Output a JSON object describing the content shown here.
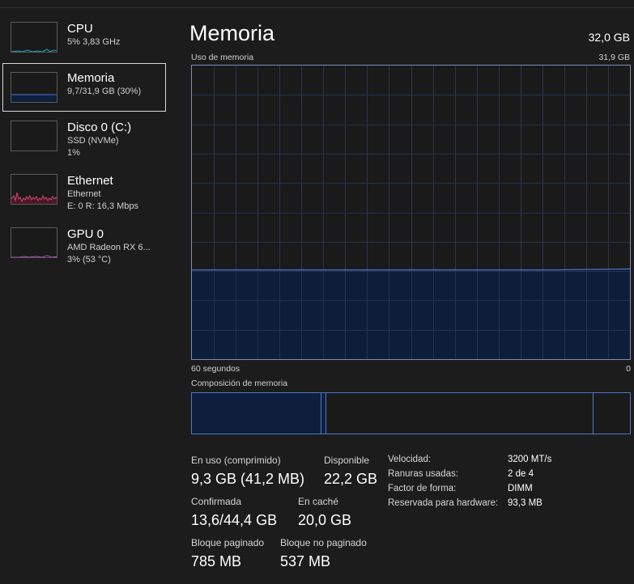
{
  "sidebar": {
    "items": [
      {
        "title": "CPU",
        "sub1": "5% 3,83 GHz",
        "sub2": "",
        "color": "#17a9c8",
        "selected": false
      },
      {
        "title": "Memoria",
        "sub1": "9,7/31,9 GB (30%)",
        "sub2": "",
        "color": "#4f77c6",
        "selected": true
      },
      {
        "title": "Disco 0 (C:)",
        "sub1": "SSD (NVMe)",
        "sub2": "1%",
        "color": "#4cae4c",
        "selected": false
      },
      {
        "title": "Ethernet",
        "sub1": "Ethernet",
        "sub2": "E: 0 R: 16,3 Mbps",
        "color": "#d2466e",
        "selected": false
      },
      {
        "title": "GPU 0",
        "sub1": "AMD Radeon RX 6...",
        "sub2": "3% (53 °C)",
        "color": "#b04ec9",
        "selected": false
      }
    ]
  },
  "header": {
    "title": "Memoria",
    "total": "32,0 GB"
  },
  "chart": {
    "label": "Uso de memoria",
    "max_label": "31,9 GB",
    "time_label": "60 segundos",
    "zero_label": "0",
    "fill_color": "#0d1f3c",
    "line_color": "#4f77c6",
    "grid_color": "#2f3545",
    "usage_fraction": 0.3
  },
  "chart_data": {
    "type": "area",
    "title": "Uso de memoria",
    "xlabel": "60 segundos",
    "ylabel": "",
    "ylim": [
      0,
      31.9
    ],
    "x": [
      60,
      50,
      40,
      30,
      20,
      10,
      0
    ],
    "series": [
      {
        "values": [
          9.7,
          9.7,
          9.7,
          9.7,
          9.7,
          9.7,
          9.8
        ]
      }
    ]
  },
  "composition": {
    "label": "Composición de memoria",
    "segments": [
      {
        "name": "en-uso",
        "fraction": 0.293,
        "fill": "#0d1f3c",
        "border": "#4f77c6"
      },
      {
        "name": "modificada",
        "fraction": 0.012,
        "fill": "#0d1f3c",
        "border": "#4f77c6"
      },
      {
        "name": "en-espera",
        "fraction": 0.61,
        "fill": "#1a1a1a",
        "border": "#4f77c6"
      },
      {
        "name": "libre",
        "fraction": 0.085,
        "fill": "#1a1a1a",
        "border": "#4f77c6"
      }
    ]
  },
  "stats": {
    "in_use_label": "En uso (comprimido)",
    "in_use_value": "9,3 GB (41,2 MB)",
    "available_label": "Disponible",
    "available_value": "22,2 GB",
    "committed_label": "Confirmada",
    "committed_value": "13,6/44,4 GB",
    "cached_label": "En caché",
    "cached_value": "20,0 GB",
    "paged_label": "Bloque paginado",
    "paged_value": "785 MB",
    "nonpaged_label": "Bloque no paginado",
    "nonpaged_value": "537 MB"
  },
  "info": {
    "speed_label": "Velocidad:",
    "speed_value": "3200 MT/s",
    "slots_label": "Ranuras usadas:",
    "slots_value": "2 de 4",
    "form_label": "Factor de forma:",
    "form_value": "DIMM",
    "reserved_label": "Reservada para hardware:",
    "reserved_value": "93,3 MB"
  }
}
